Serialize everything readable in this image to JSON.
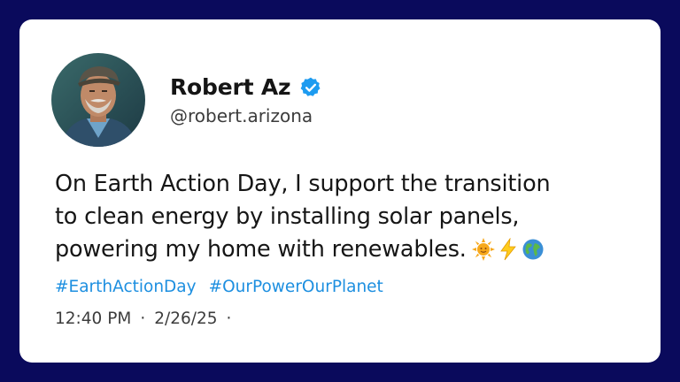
{
  "post": {
    "author": {
      "display_name": "Robert Az",
      "handle": "@robert.arizona",
      "verified_icon": "verified-badge-icon",
      "avatar": "avatar-photo"
    },
    "text_lines": [
      "On Earth Action Day, I support the transition",
      "to clean energy by installing solar panels,",
      "powering my home with renewables."
    ],
    "emojis": [
      "sun-emoji-icon",
      "lightning-emoji-icon",
      "globe-emoji-icon"
    ],
    "hashtags": [
      "#EarthActionDay",
      "#OurPowerOurPlanet"
    ],
    "time": "12:40 PM",
    "separator": "·",
    "date": "2/26/25",
    "trailing_separator": "·"
  },
  "colors": {
    "background": "#0a0a5c",
    "card": "#ffffff",
    "hashtag": "#1d8fe0",
    "verified": "#1d9bf0",
    "text": "#161616"
  }
}
